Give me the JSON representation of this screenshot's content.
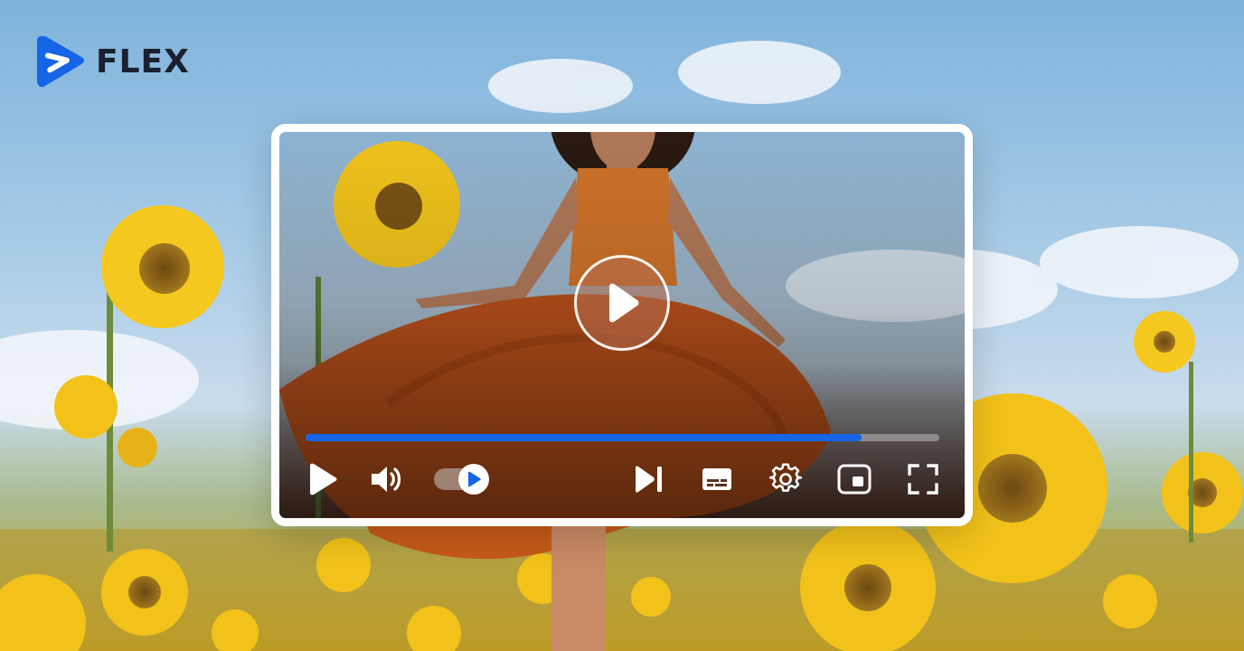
{
  "brand": {
    "name": "FLEX",
    "color": "#1565e6"
  },
  "player": {
    "progress_fraction": 0.878,
    "progress_color": "#1565e6",
    "autoplay_enabled": true,
    "icons": {
      "big_play": "play-icon",
      "play": "play-icon",
      "volume": "volume-icon",
      "autoplay": "autoplay-toggle",
      "next": "skip-next-icon",
      "captions": "captions-icon",
      "settings": "gear-icon",
      "miniplayer": "miniplayer-icon",
      "fullscreen": "fullscreen-icon"
    }
  }
}
